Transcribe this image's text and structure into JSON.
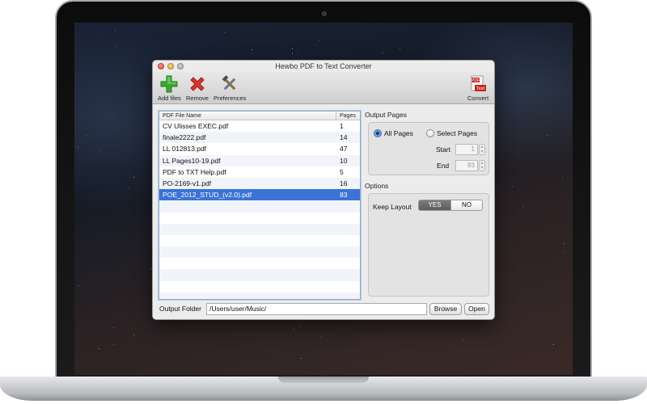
{
  "window": {
    "title": "Hewbo PDF to Text Converter"
  },
  "toolbar": {
    "add_files": {
      "label": "Add files",
      "icon": "plus-icon",
      "color": "#3aa82f"
    },
    "remove": {
      "label": "Remove",
      "icon": "x-icon",
      "color": "#d9362c"
    },
    "preferences": {
      "label": "Preferences",
      "icon": "tools-icon"
    },
    "convert": {
      "label": "Convert",
      "icon": "pdf-to-text-icon",
      "badge_top": "PDF",
      "badge_bottom": "Text"
    }
  },
  "file_list": {
    "columns": [
      "PDF File Name",
      "Pages"
    ],
    "rows": [
      {
        "name": "CV Ulisses EXEC.pdf",
        "pages": "1"
      },
      {
        "name": "finale2222.pdf",
        "pages": "14"
      },
      {
        "name": "LL 012813.pdf",
        "pages": "47"
      },
      {
        "name": "LL Pages10-19.pdf",
        "pages": "10"
      },
      {
        "name": "PDF to TXT Help.pdf",
        "pages": "5"
      },
      {
        "name": "PO-2169-v1.pdf",
        "pages": "16"
      },
      {
        "name": "POE_2012_STUD_(v2.0).pdf",
        "pages": "83"
      }
    ],
    "selected_index": 6,
    "selection_color": "#3b73d6"
  },
  "output_pages": {
    "title": "Output Pages",
    "all_pages_label": "All Pages",
    "select_pages_label": "Select Pages",
    "selected": "All Pages",
    "start_label": "Start",
    "start_value": "1",
    "end_label": "End",
    "end_value": "83"
  },
  "options": {
    "title": "Options",
    "keep_layout_label": "Keep Layout",
    "yes_label": "YES",
    "no_label": "NO",
    "keep_layout_value": "YES"
  },
  "output_folder": {
    "label": "Output Folder",
    "path": "/Users/user/Music/",
    "browse_label": "Browse",
    "open_label": "Open"
  }
}
